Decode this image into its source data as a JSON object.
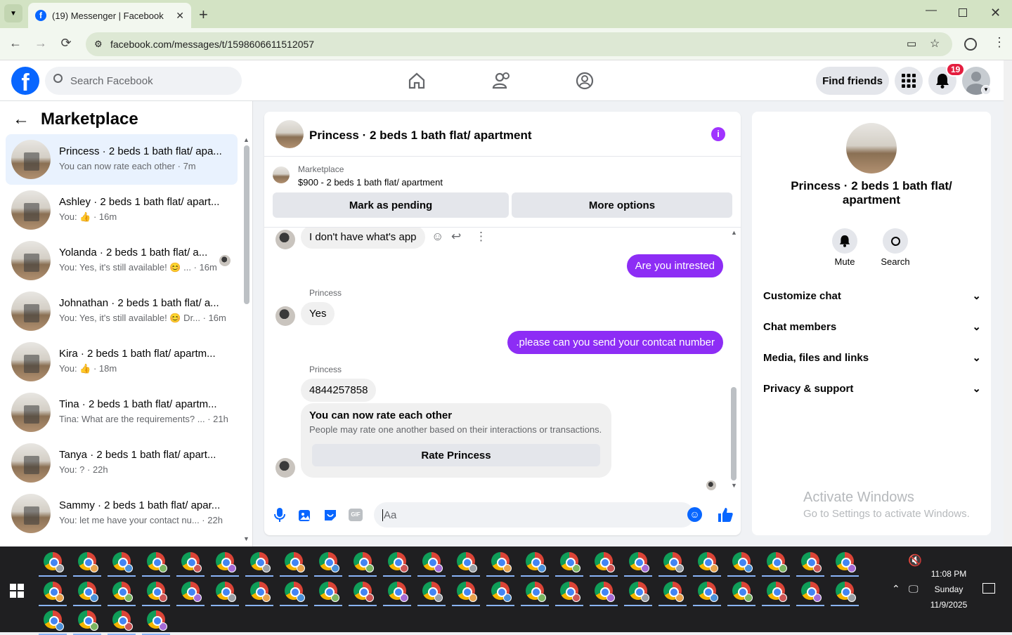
{
  "browser": {
    "tab_title": "(19) Messenger | Facebook",
    "url": "facebook.com/messages/t/1598606611512057"
  },
  "fb": {
    "search_placeholder": "Search Facebook",
    "find_friends": "Find friends",
    "notif_count": "19"
  },
  "sidebar": {
    "title": "Marketplace",
    "conversations": [
      {
        "name": "Princess · 2 beds 1 bath flat/ apa...",
        "snippet": "You can now rate each other · 7m",
        "active": true
      },
      {
        "name": "Ashley · 2 beds 1 bath flat/ apart...",
        "snippet": "You: 👍 · 16m"
      },
      {
        "name": "Yolanda · 2 beds 1 bath flat/ a...",
        "snippet": "You: Yes, it's still available! 😊 ... · 16m"
      },
      {
        "name": "Johnathan · 2 beds 1 bath flat/ a...",
        "snippet": "You: Yes, it's still available! 😊 Dr... · 16m"
      },
      {
        "name": "Kira · 2 beds 1 bath flat/ apartm...",
        "snippet": "You: 👍 · 18m"
      },
      {
        "name": "Tina · 2 beds 1 bath flat/ apartm...",
        "snippet": "Tina: What are the requirements? ... · 21h"
      },
      {
        "name": "Tanya · 2 beds 1 bath flat/ apart...",
        "snippet": "You: ? · 22h"
      },
      {
        "name": "Sammy · 2 beds 1 bath flat/ apar...",
        "snippet": "You: let me have your contact nu... · 22h"
      }
    ]
  },
  "chat": {
    "title": "Princess · 2 beds 1 bath flat/ apartment",
    "market_label": "Marketplace",
    "listing": "$900 - 2 beds 1 bath flat/ apartment",
    "mark_pending": "Mark as pending",
    "more_options": "More options",
    "messages": {
      "m1": "I don't have what's app",
      "m2": "Are you intrested",
      "sender": "Princess",
      "m3": "Yes",
      "m4": ".please can you send your contcat number",
      "m5": "4844257858",
      "rate_title": "You can now rate each other",
      "rate_sub": "People may rate one another based on their interactions or transactions.",
      "rate_button": "Rate Princess"
    },
    "composer_placeholder": "Aa"
  },
  "info": {
    "title": "Princess · 2 beds 1 bath flat/ apartment",
    "mute": "Mute",
    "search": "Search",
    "items": [
      "Customize chat",
      "Chat members",
      "Media, files and links",
      "Privacy & support"
    ],
    "watermark1": "Activate Windows",
    "watermark2": "Go to Settings to activate Windows."
  },
  "taskbar": {
    "time": "11:08 PM",
    "day": "Sunday",
    "date": "11/9/2025"
  },
  "colors": {
    "fb_blue": "#0866ff",
    "outgoing_bubble": "#8d2df5",
    "info_icon": "#a033ff"
  }
}
